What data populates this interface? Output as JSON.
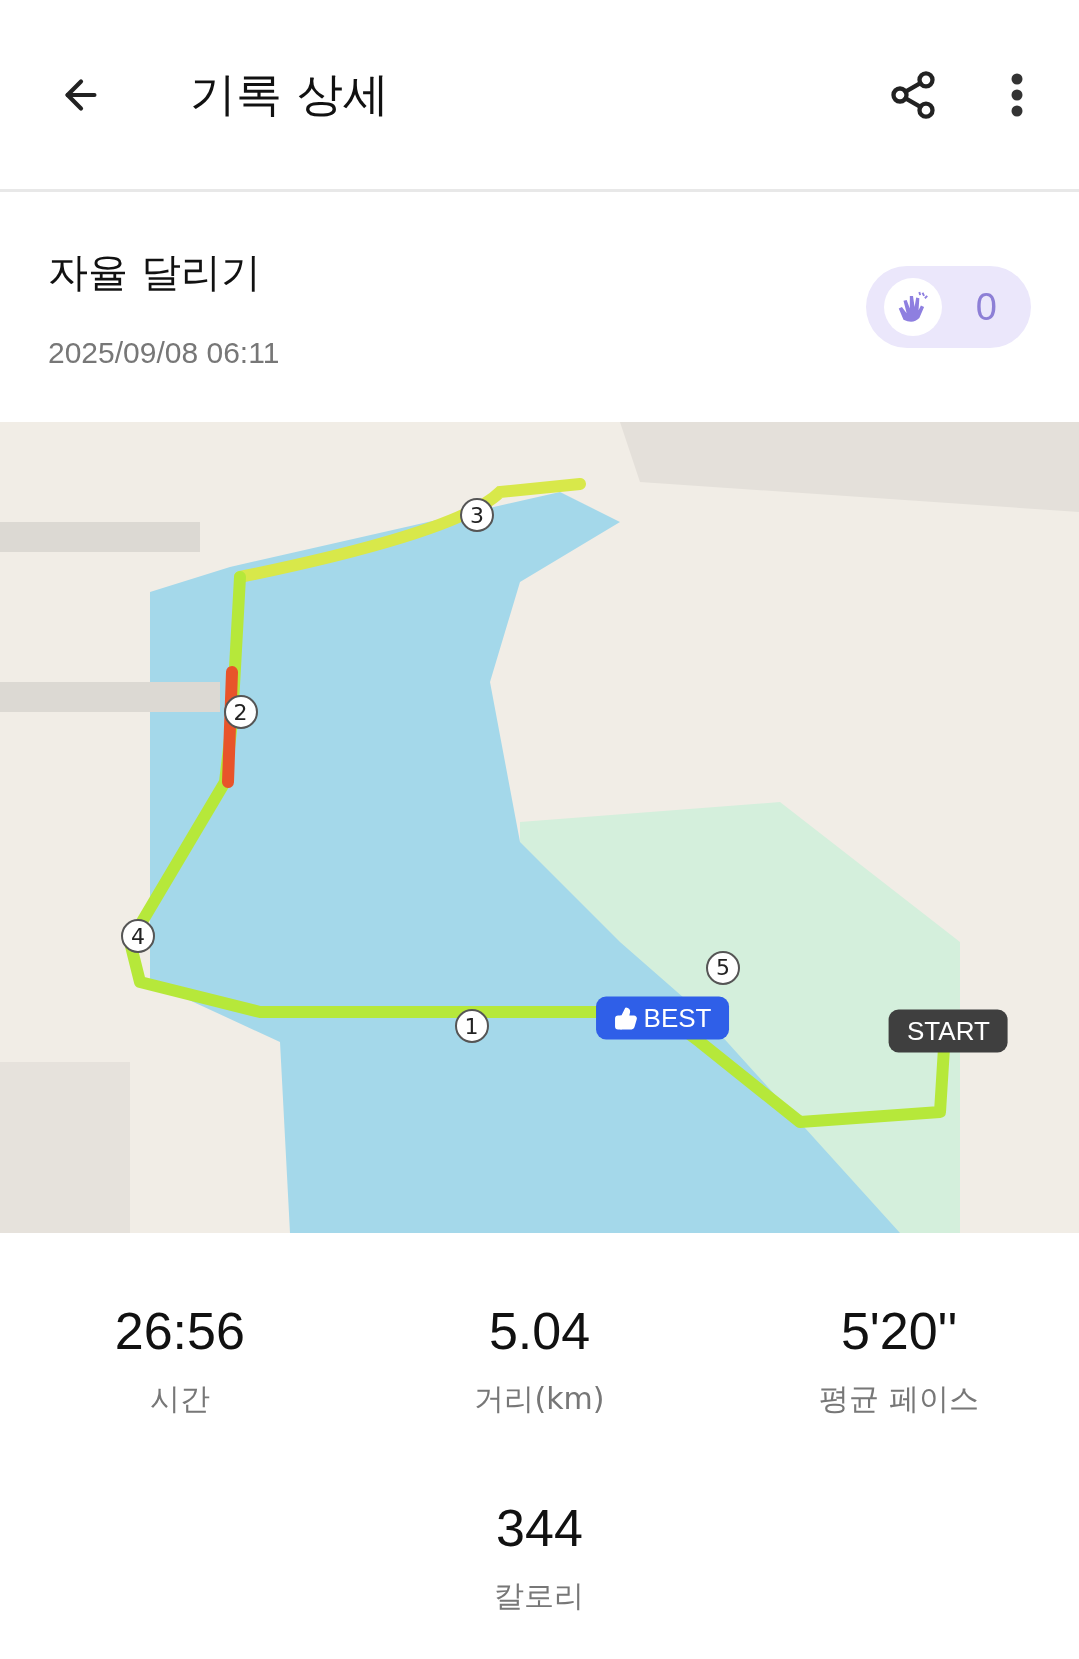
{
  "header": {
    "title": "기록 상세"
  },
  "record": {
    "name": "자율 달리기",
    "date": "2025/09/08 06:11",
    "claps": "0"
  },
  "map": {
    "markers": [
      "1",
      "2",
      "3",
      "4",
      "5"
    ],
    "badges": [
      {
        "kind": "best",
        "label": "BEST"
      },
      {
        "kind": "start",
        "label": "START"
      }
    ]
  },
  "stats": [
    {
      "value": "26:56",
      "label": "시간"
    },
    {
      "value": "5.04",
      "label": "거리(km)"
    },
    {
      "value": "5'20''",
      "label": "평균 페이스"
    },
    {
      "value": "344",
      "label": "칼로리"
    }
  ]
}
